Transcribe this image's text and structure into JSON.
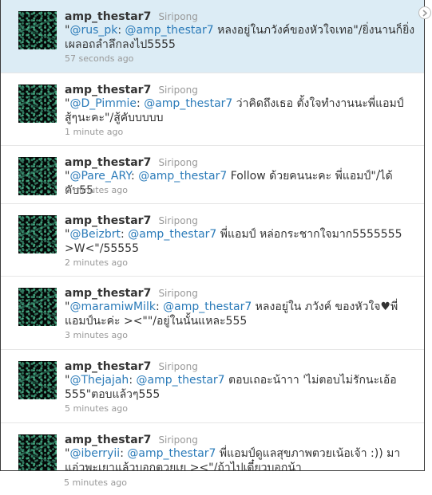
{
  "tweets": [
    {
      "username": "amp_thestar7",
      "realname": "Siripong",
      "open_quote": "\"",
      "mention1": "@rus_pk",
      "sep": ": ",
      "mention2": "@amp_thestar7",
      "body": " หลงอยู่ในภวังค์ของหัวใจเทอ\"/ยิ่งนานก็ยิ่งเผลอถลำลึกลงไป5555",
      "time": "57 seconds ago",
      "highlighted": true
    },
    {
      "username": "amp_thestar7",
      "realname": "Siripong",
      "open_quote": "\"",
      "mention1": "@D_Pimmie",
      "sep": ": ",
      "mention2": "@amp_thestar7",
      "body": " ว่าคิดถึงเธอ ตั้งใจทำงานนะพี่แอมป์ สู้ๆนะคะ\"/สู้คับบบบบ",
      "time": "1 minute ago"
    },
    {
      "username": "amp_thestar7",
      "realname": "Siripong",
      "open_quote": "\"",
      "mention1": "@Pare_ARY",
      "sep": ": ",
      "mention2": "@amp_thestar7",
      "body": " Follow ด้วยคนนะคะ พี่แอมป์\"/ได้คับ55",
      "time": "2 minutes ago"
    },
    {
      "username": "amp_thestar7",
      "realname": "Siripong",
      "open_quote": "\"",
      "mention1": "@Beizbrt",
      "sep": ": ",
      "mention2": "@amp_thestar7",
      "body": " พี่แอมป์ หล่อกระชากใจมาก5555555 >W<\"/55555",
      "time": "2 minutes ago"
    },
    {
      "username": "amp_thestar7",
      "realname": "Siripong",
      "open_quote": "\"",
      "mention1": "@maramiwMilk",
      "sep": ": ",
      "mention2": "@amp_thestar7",
      "body": " หลงอยู่ใน ภวังค์ ของหัวใจ♥พี่แอมป์นะค่ะ ><\"\"/อยู่ในนั้นแหละ555",
      "time": "3 minutes ago"
    },
    {
      "username": "amp_thestar7",
      "realname": "Siripong",
      "open_quote": "\"",
      "mention1": "@Thejajah",
      "sep": ": ",
      "mention2": "@amp_thestar7",
      "body": " ตอบเถอะน้าาา 'ไม่ตอบไม่รักนะเอ้อ 555\"ตอบแล้วๆ555",
      "time": "5 minutes ago"
    },
    {
      "username": "amp_thestar7",
      "realname": "Siripong",
      "open_quote": "\"",
      "mention1": "@iberryii",
      "sep": ": ",
      "mention2": "@amp_thestar7",
      "body": " พี่แอมป์ดูแลสุขภาพตวยเน้อเจ้า :)) มาแอ่วพะเยาแล้วบอกตวยเย ><\"/ถ้าไปเดี๋ยวบอกน้า",
      "time": "5 minutes ago"
    }
  ]
}
